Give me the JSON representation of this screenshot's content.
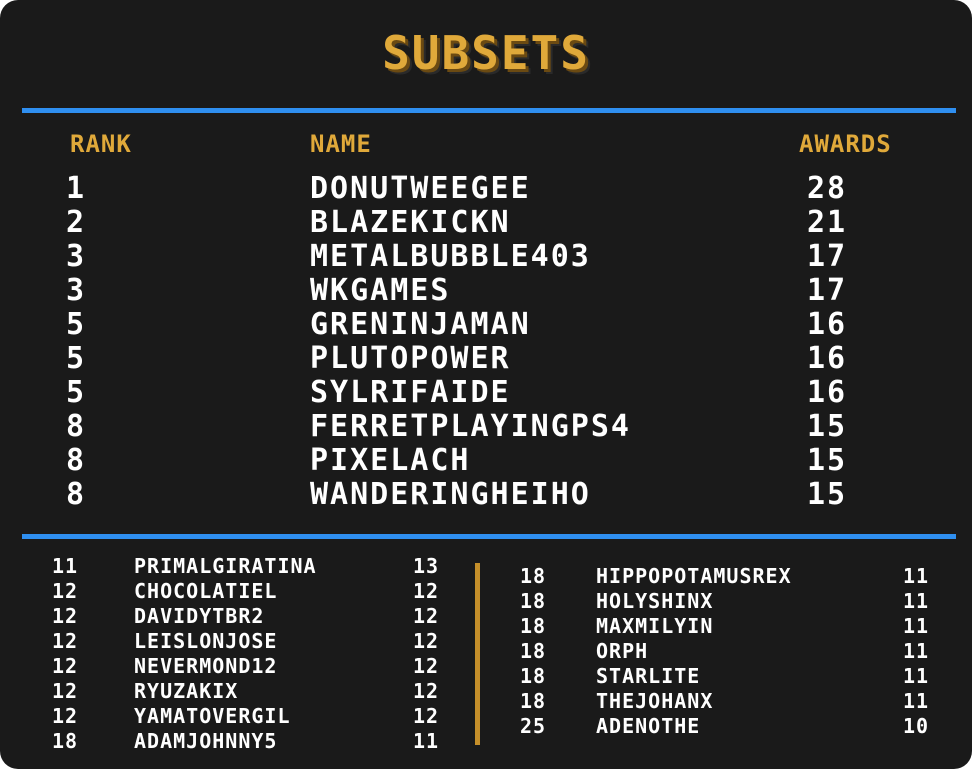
{
  "title": "SUBSETS",
  "headers": {
    "rank": "RANK",
    "name": "NAME",
    "awards": "AWARDS"
  },
  "top": [
    {
      "rank": "1",
      "name": "DONUTWEEGEE",
      "awards": "28"
    },
    {
      "rank": "2",
      "name": "BLAZEKICKN",
      "awards": "21"
    },
    {
      "rank": "3",
      "name": "METALBUBBLE403",
      "awards": "17"
    },
    {
      "rank": "3",
      "name": "WKGAMES",
      "awards": "17"
    },
    {
      "rank": "5",
      "name": "GRENINJAMAN",
      "awards": "16"
    },
    {
      "rank": "5",
      "name": "PLUTOPOWER",
      "awards": "16"
    },
    {
      "rank": "5",
      "name": "SYLRIFAIDE",
      "awards": "16"
    },
    {
      "rank": "8",
      "name": "FERRETPLAYINGPS4",
      "awards": "15"
    },
    {
      "rank": "8",
      "name": "PIXELACH",
      "awards": "15"
    },
    {
      "rank": "8",
      "name": "WANDERINGHEIHO",
      "awards": "15"
    }
  ],
  "left": [
    {
      "rank": "11",
      "name": "PRIMALGIRATINA",
      "awards": "13"
    },
    {
      "rank": "12",
      "name": "CHOCOLATIEL",
      "awards": "12"
    },
    {
      "rank": "12",
      "name": "DAVIDYTBR2",
      "awards": "12"
    },
    {
      "rank": "12",
      "name": "LEISLONJOSE",
      "awards": "12"
    },
    {
      "rank": "12",
      "name": "NEVERMOND12",
      "awards": "12"
    },
    {
      "rank": "12",
      "name": "RYUZAKIX",
      "awards": "12"
    },
    {
      "rank": "12",
      "name": "YAMATOVERGIL",
      "awards": "12"
    },
    {
      "rank": "18",
      "name": "ADAMJOHNNY5",
      "awards": "11"
    }
  ],
  "right": [
    {
      "rank": "18",
      "name": "HIPPOPOTAMUSREX",
      "awards": "11"
    },
    {
      "rank": "18",
      "name": "HOLYSHINX",
      "awards": "11"
    },
    {
      "rank": "18",
      "name": "MAXMILYIN",
      "awards": "11"
    },
    {
      "rank": "18",
      "name": "ORPH",
      "awards": "11"
    },
    {
      "rank": "18",
      "name": "STARLITE",
      "awards": "11"
    },
    {
      "rank": "18",
      "name": "THEJOHANX",
      "awards": "11"
    },
    {
      "rank": "25",
      "name": "ADENOTHE",
      "awards": "10"
    }
  ],
  "colors": {
    "background": "#1a1a1a",
    "accent_gold": "#e0a93a",
    "divider_blue": "#2f8ff0",
    "text": "#ffffff"
  }
}
